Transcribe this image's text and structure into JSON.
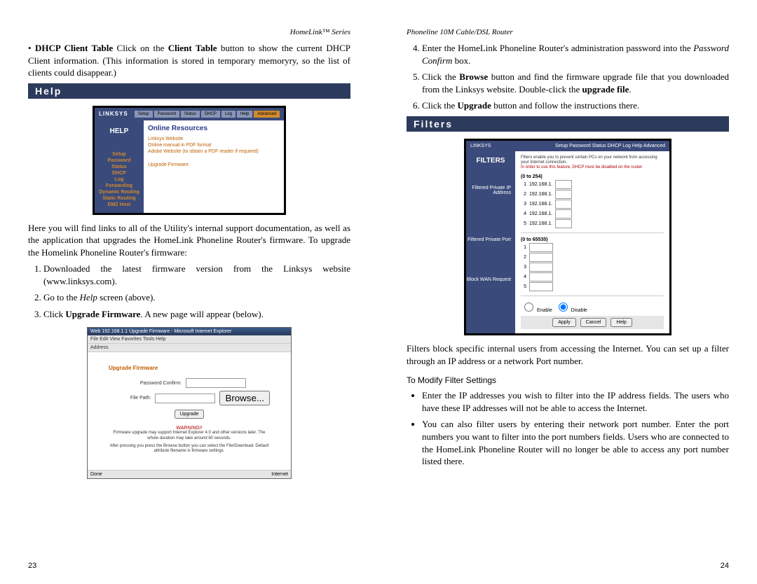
{
  "left": {
    "header": "HomeLink™ Series",
    "dhcp_bullet_prefix": "• ",
    "dhcp_bold1": "DHCP Client Table",
    "dhcp_text1": "  Click on the ",
    "dhcp_bold2": "Client Table",
    "dhcp_text2": " button to show the current DHCP Client information. (This information is stored in temporary memory­ry, so the list of clients could disappear.)",
    "help_heading": "Help",
    "para1": "Here you will find links to all of the Utility's internal support documentation, as well as the application that upgrades the HomeLink Phoneline Router's firmware. To upgrade the Homelink Phoneline Router's firmware:",
    "step1": "Downloaded the latest firmware version from the Linksys website (www.linksys.com).",
    "step2_a": "Go to the ",
    "step2_i": "Help",
    "step2_b": " screen (above).",
    "step3_a": "Click ",
    "step3_bold": "Upgrade Firmware",
    "step3_b": ". A new page will appear (below).",
    "pagenum": "23"
  },
  "right": {
    "header": "Phoneline 10M Cable/DSL Router",
    "step4_a": "Enter the HomeLink Phoneline Router's administration password into the ",
    "step4_i": "Password Confirm",
    "step4_b": " box.",
    "step5_a": "Click the ",
    "step5_bold1": "Browse",
    "step5_b": " button and find the firmware upgrade file that you down­loaded from the Linksys website. Double-click the ",
    "step5_bold2": "upgrade file",
    "step5_c": ".",
    "step6_a": "Click the ",
    "step6_bold": "Upgrade",
    "step6_b": " button and follow the instructions there.",
    "filters_heading": "Filters",
    "filters_para": "Filters block specific internal users from accessing the Internet. You can set up a filter through an IP address or a network Port number.",
    "subhead": "To Modify Filter Settings",
    "bullet1": "Enter the IP addresses you wish to filter into the IP address fields. The users who have these IP addresses will not be able to access the Internet.",
    "bullet2": "You can also filter users by entering their network port number. Enter the port numbers you want to filter into the port numbers fields. Users who are connected to the HomeLink Phoneline Router will no longer be able to access any port number listed there.",
    "pagenum": "24"
  },
  "fig1": {
    "brand": "LINKSYS",
    "tabs": [
      "Setup",
      "Password",
      "Status",
      "DHCP",
      "Log",
      "Help",
      "Advanced"
    ],
    "left_label": "HELP",
    "panel_title": "Online Resources",
    "sidelinks": [
      "Setup",
      "Password",
      "Status",
      "DHCP",
      "Log",
      "Forwarding",
      "Dynamic Routing",
      "Static Routing",
      "DMZ Host"
    ],
    "mainlinks": [
      "Linksys Website",
      "Online manual in PDF format",
      "Adobe Website (to obtain a PDF reader if required)"
    ],
    "upgrade_link": "Upgrade Firmware"
  },
  "fig2": {
    "titlebar": "Web 192.168.1.1 Upgrade Firmware - Microsoft Internet Explorer",
    "menubar": "File  Edit  View  Favorites  Tools  Help",
    "addr_label": "Address",
    "content_title": "Upgrade Firmware",
    "pw_label": "Password Confirm:",
    "file_label": "File Path:",
    "browse_btn": "Browse...",
    "upgrade_btn": "Upgrade",
    "warning": "WARNING!!",
    "warntxt1": "Firmware upgrade may support Internet Explorer 4.0 and other versions later. The whole duration may take around 60 seconds.",
    "warntxt2": "After pressing you press the Browse button you can select the File/Download. Default attribute filename is firmware settings.",
    "status_left": "Done",
    "status_right": "Internet"
  },
  "fig3": {
    "brand": "LINKSYS",
    "tabs": [
      "Setup",
      "Password",
      "Status",
      "DHCP",
      "Log",
      "Help",
      "Advanced"
    ],
    "left_label": "FILTERS",
    "desc1": "Filters enable you to prevent certain PCs on your network from accessing your Internet connection.",
    "desc2": "In order to use this feature, DHCP must be disabled on the router.",
    "sublabel1": "Filtered Private IP Address",
    "range_hdr": "(0 to 254)",
    "ip_prefix": "192.168.1.",
    "sublabel2": "Filtered Private Port",
    "port_range": "(0 to 65535)",
    "sublabel3": "Block WAN Request",
    "radio_enable": "Enable",
    "radio_disable": "Disable",
    "btn_apply": "Apply",
    "btn_cancel": "Cancel",
    "btn_help": "Help"
  }
}
